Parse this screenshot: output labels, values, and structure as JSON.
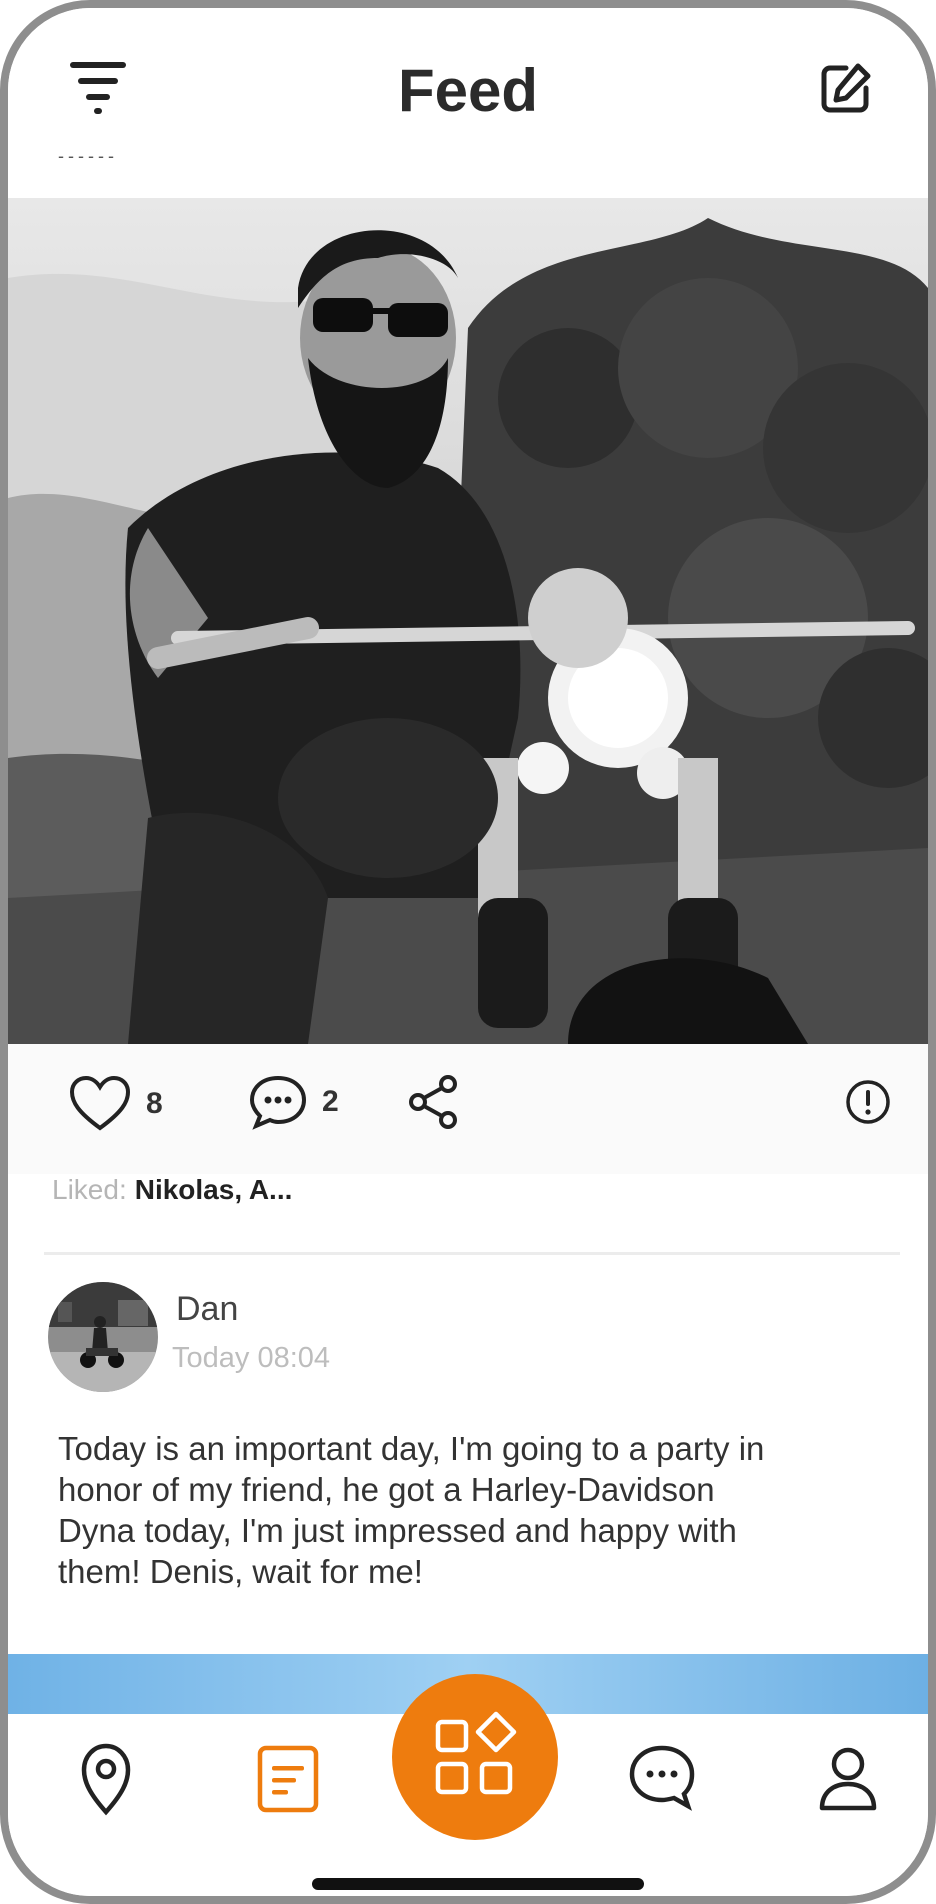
{
  "header": {
    "title": "Feed",
    "subtitle_dashes": "------"
  },
  "post": {
    "likes": "8",
    "comments": "2",
    "liked_label": "Liked:",
    "liked_names": "Nikolas, A...",
    "author": "Dan",
    "time": "Today 08:04",
    "text": "Today is an important day, I'm going to a party in honor of my friend, he got a Harley-Davidson Dyna today, I'm just impressed and happy with them! Denis, wait for me!"
  },
  "icons": {
    "filter": "filter-icon",
    "edit": "edit-icon",
    "like": "heart-icon",
    "comment": "comment-icon",
    "share": "share-icon",
    "report": "report-icon",
    "map": "map-pin-icon",
    "feed": "feed-icon",
    "apps": "apps-icon",
    "chat": "chat-icon",
    "profile": "profile-icon"
  },
  "colors": {
    "accent": "#ee7c0e",
    "text": "#333333",
    "muted": "#bdbdbd"
  }
}
